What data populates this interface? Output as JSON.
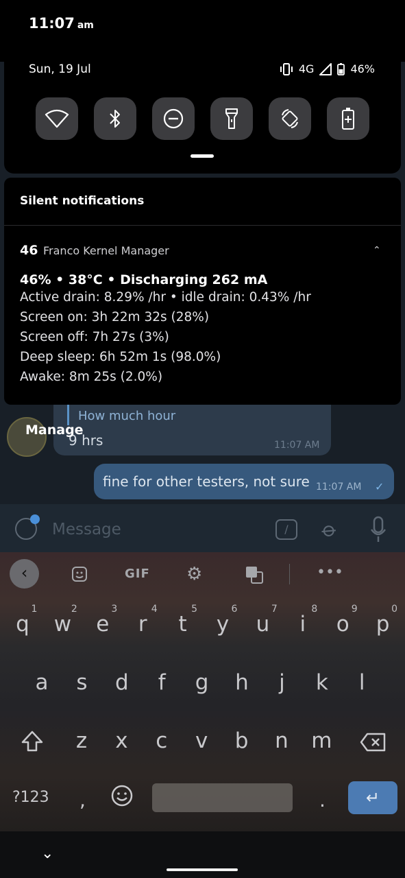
{
  "status": {
    "time": "11:07",
    "ampm": "am",
    "date": "Sun, 19 Jul",
    "network": "4G",
    "battery": "46%"
  },
  "quick_tiles": [
    "wifi-icon",
    "bluetooth-icon",
    "do-not-disturb-icon",
    "flashlight-icon",
    "auto-rotate-icon",
    "battery-saver-icon"
  ],
  "notifications": {
    "section_title": "Silent notifications",
    "app_badge": "46",
    "app_name": "Franco Kernel Manager",
    "headline": "46% • 38°C • Discharging 262 mA",
    "lines": [
      "Active drain: 8.29% /hr • idle drain: 0.43% /hr",
      "Screen on: 3h 22m 32s  (28%)",
      "Screen off: 7h 27s  (3%)",
      "Deep sleep: 6h 52m 1s  (98.0%)",
      "Awake: 8m 25s  (2.0%)"
    ]
  },
  "chat": {
    "avatar_label": "Manage",
    "quoted_text": "How much hour",
    "incoming_text": "9 hrs",
    "incoming_time": "11:07 AM",
    "outgoing_text": "fine for other testers, not sure",
    "outgoing_time": "11:07 AM",
    "input_placeholder": "Message",
    "command_glyph": "/"
  },
  "keyboard": {
    "toolbar": {
      "gif_label": "GIF"
    },
    "row1": [
      "q",
      "w",
      "e",
      "r",
      "t",
      "y",
      "u",
      "i",
      "o",
      "p"
    ],
    "row1_hints": [
      "1",
      "2",
      "3",
      "4",
      "5",
      "6",
      "7",
      "8",
      "9",
      "0"
    ],
    "row2": [
      "a",
      "s",
      "d",
      "f",
      "g",
      "h",
      "j",
      "k",
      "l"
    ],
    "row3": [
      "z",
      "x",
      "c",
      "v",
      "b",
      "n",
      "m"
    ],
    "symbols_label": "?123",
    "comma": ",",
    "period": "."
  }
}
